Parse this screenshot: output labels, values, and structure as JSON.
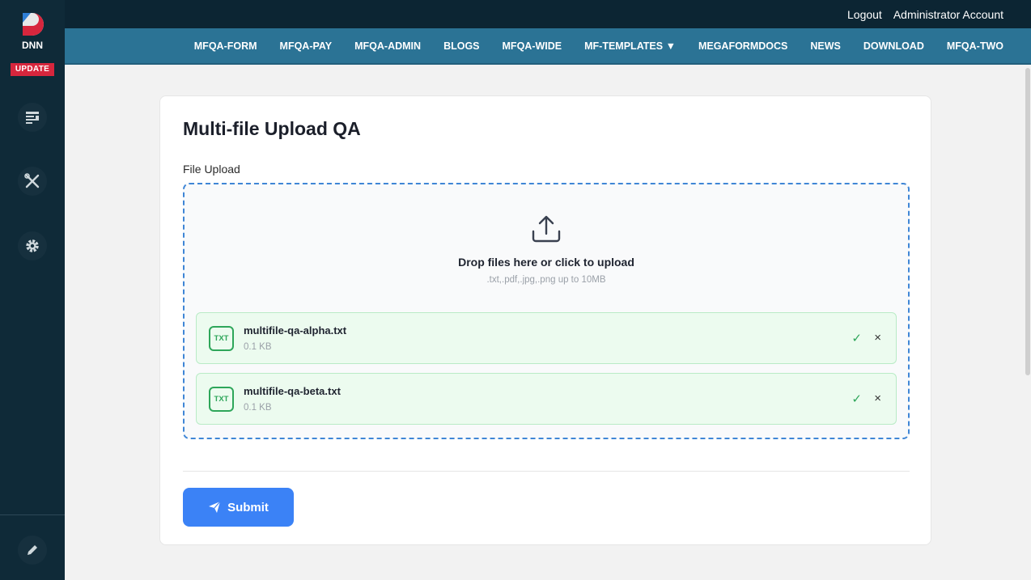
{
  "sidebar": {
    "logo_text": "DNN",
    "update_badge": "UPDATE",
    "icons": [
      "content-icon",
      "tools-icon",
      "settings-icon",
      "edit-icon"
    ]
  },
  "topbar": {
    "logout": "Logout",
    "account": "Administrator Account"
  },
  "nav": {
    "items": [
      {
        "label": "MFQA-FORM"
      },
      {
        "label": "MFQA-PAY"
      },
      {
        "label": "MFQA-ADMIN"
      },
      {
        "label": "BLOGS"
      },
      {
        "label": "MFQA-WIDE"
      },
      {
        "label": "MF-TEMPLATES ▼"
      },
      {
        "label": "MEGAFORMDOCS"
      },
      {
        "label": "NEWS"
      },
      {
        "label": "DOWNLOAD"
      },
      {
        "label": "MFQA-TWO"
      }
    ]
  },
  "form": {
    "title": "Multi-file Upload QA",
    "field_label": "File Upload",
    "dropzone": {
      "title": "Drop files here or click to upload",
      "hint": ".txt,.pdf,.jpg,.png up to 10MB"
    },
    "files": [
      {
        "type": "TXT",
        "name": "multifile-qa-alpha.txt",
        "size": "0.1 KB",
        "status": "✓",
        "remove": "×"
      },
      {
        "type": "TXT",
        "name": "multifile-qa-beta.txt",
        "size": "0.1 KB",
        "status": "✓",
        "remove": "×"
      }
    ],
    "submit_label": "Submit"
  },
  "colors": {
    "sidebar": "#0f2a38",
    "navbar": "#2b7395",
    "accent": "#3b82f6",
    "success": "#2ea65a",
    "badge": "#d7263d"
  }
}
